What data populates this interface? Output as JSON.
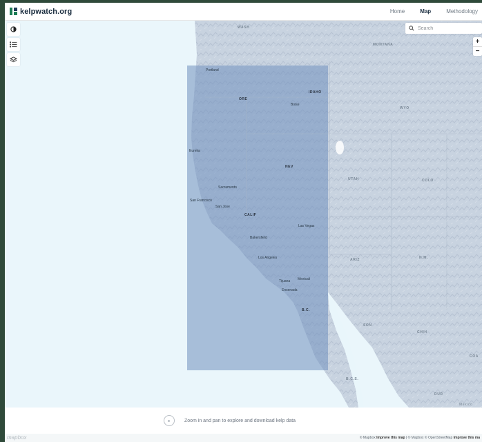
{
  "header": {
    "logo_text": "kelpwatch.org",
    "nav": [
      {
        "label": "Home",
        "active": false
      },
      {
        "label": "Map",
        "active": true
      },
      {
        "label": "Methodology",
        "active": false
      }
    ]
  },
  "search": {
    "placeholder": "Search"
  },
  "zoom": {
    "in_label": "+",
    "out_label": "−"
  },
  "toolbar": {
    "icons": [
      "half-circle-icon",
      "legend-list-icon",
      "layers-icon"
    ]
  },
  "map_labels": {
    "states": {
      "wash": "WASH",
      "montana": "MONTANA",
      "idaho": "IDAHO",
      "ore": "ORE",
      "wyo": "WYO",
      "nev": "NEV",
      "utah": "UTAH",
      "colo": "COLO",
      "calif": "CALIF",
      "ariz": "ARIZ",
      "nm": "N.M.",
      "bc": "B.C.",
      "son": "SON",
      "chih": "CHIH",
      "bcs": "B.C.S.",
      "dur": "DUR",
      "coa": "COA"
    },
    "cities": {
      "portland": "Portland",
      "boise": "Boise",
      "eureka": "Eureka",
      "sacramento": "Sacramento",
      "san_francisco": "San Francisco",
      "san_jose": "San Jose",
      "las_vegas": "Las Vegas",
      "bakersfield": "Bakersfield",
      "los_angeles": "Los Angeles",
      "tijuana": "Tijuana",
      "mexicali": "Mexicali",
      "ensenada": "Ensenada",
      "mexico": "Mexico"
    }
  },
  "bottom_panel": {
    "hint": "Zoom in and pan to explore and download kelp data"
  },
  "attribution": {
    "logo": "mapbox",
    "mapbox": "© Mapbox",
    "improve": "Improve this map",
    "mapbox2": "© Mapbox",
    "osm": "© OpenStreetMap",
    "improve2": "Improve this ma"
  },
  "colors": {
    "selection_overlay": "#6f8fbd",
    "water": "#e9f6fb",
    "land": "#c9d4e1",
    "accent": "#1c7c54"
  }
}
